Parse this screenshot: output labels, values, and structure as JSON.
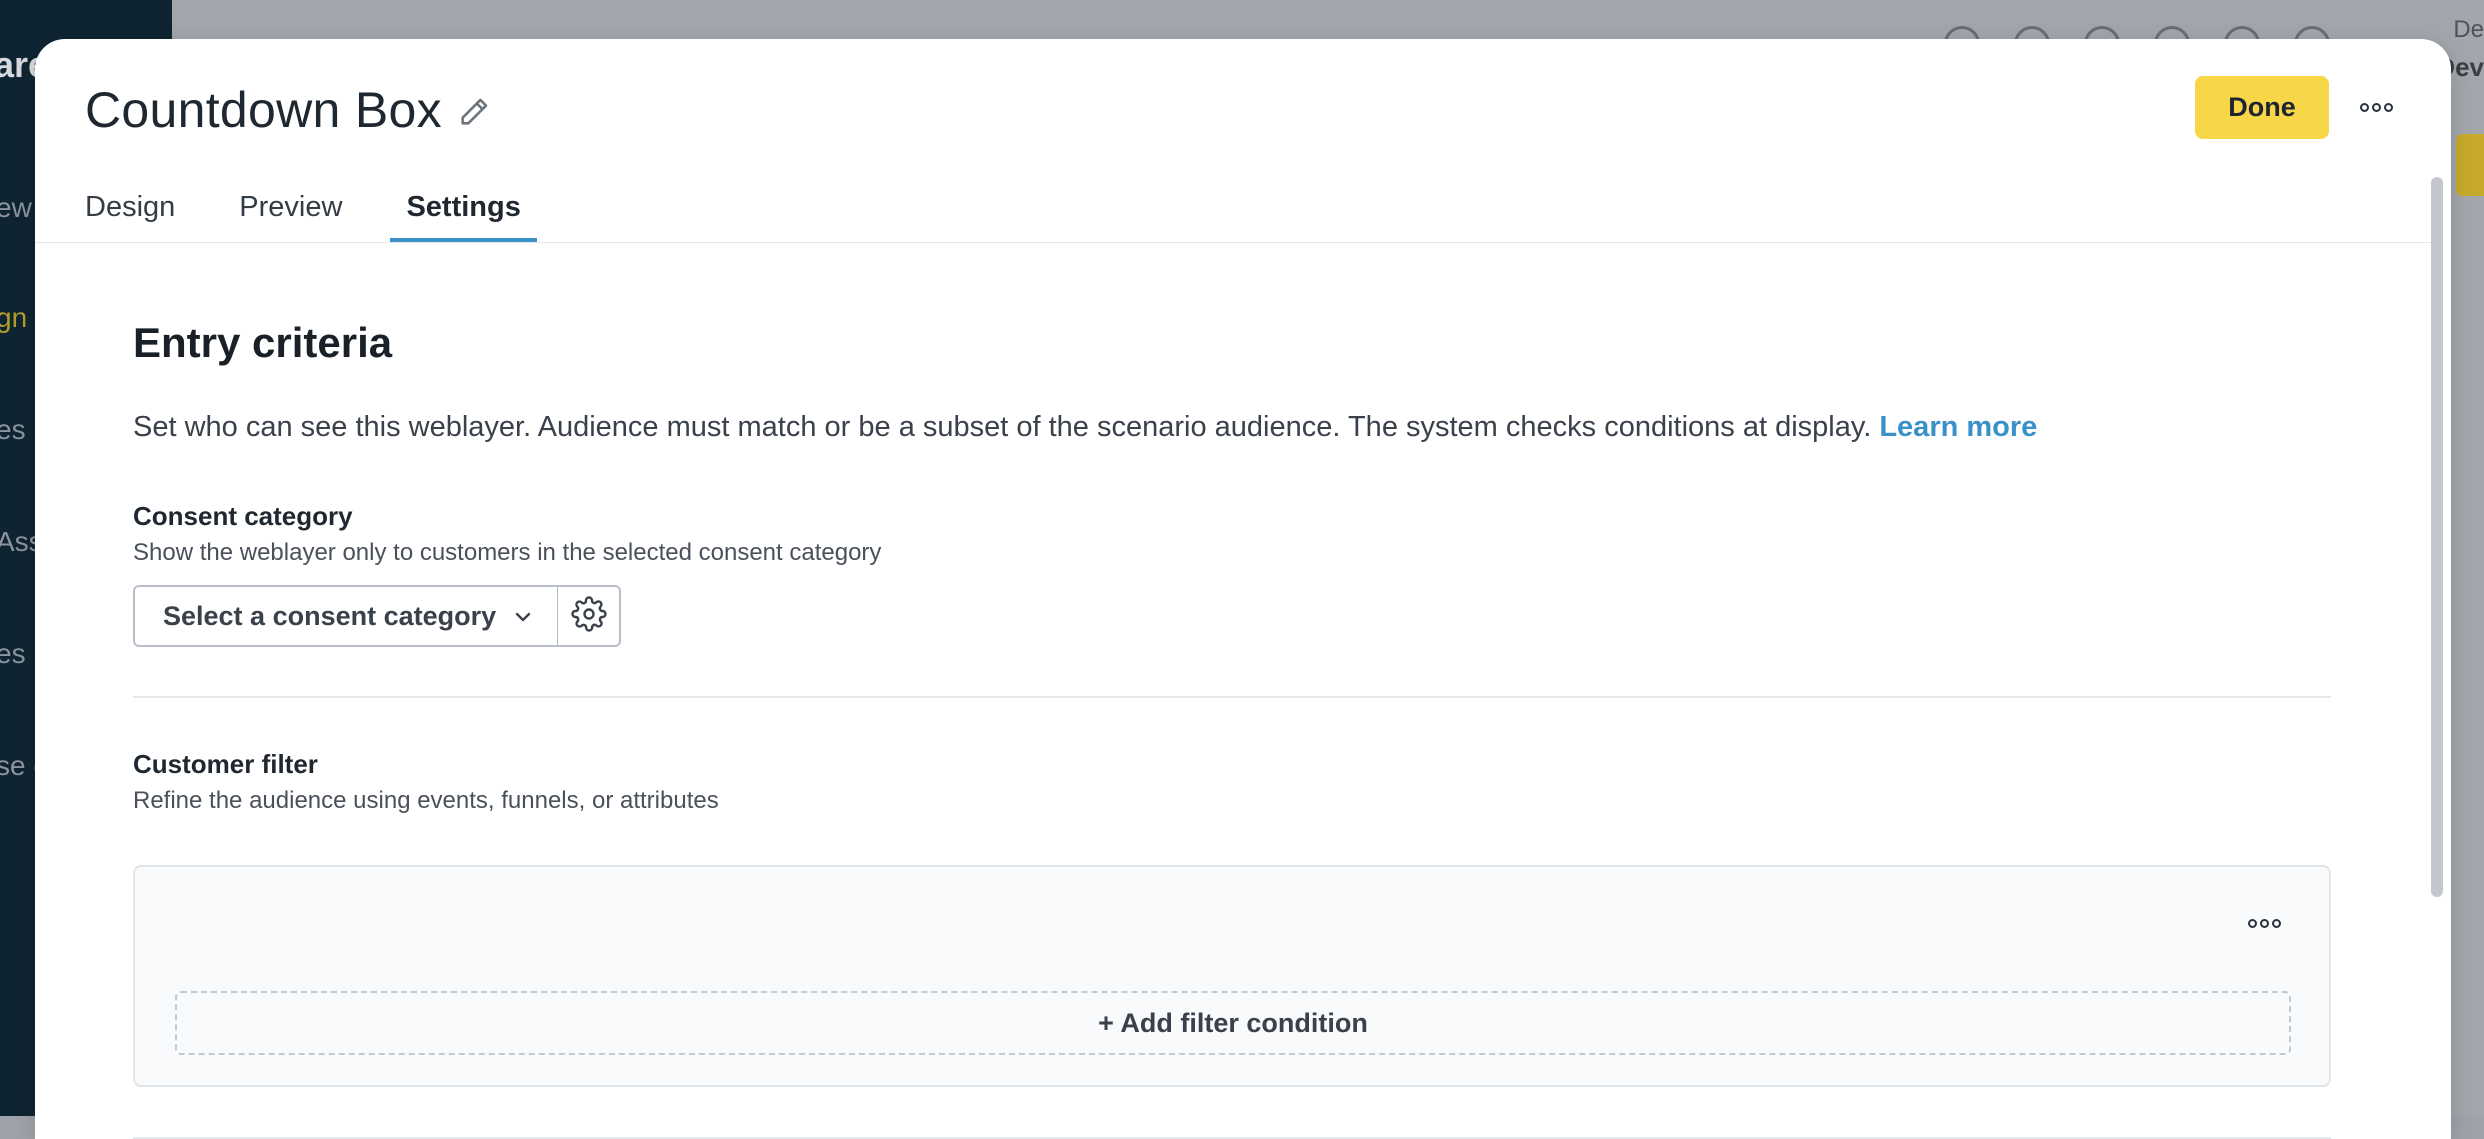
{
  "background": {
    "sidebar_logo": "are",
    "sidebar_items": [
      "ew",
      "gn",
      "es",
      "Ass",
      "es",
      "se c"
    ],
    "user_name": "De",
    "user_org": "Dev"
  },
  "modal": {
    "title": "Countdown Box",
    "done_label": "Done",
    "tabs": [
      {
        "label": "Design",
        "active": false
      },
      {
        "label": "Preview",
        "active": false
      },
      {
        "label": "Settings",
        "active": true
      }
    ]
  },
  "entry_criteria": {
    "heading": "Entry criteria",
    "description": "Set who can see this weblayer. Audience must match or be a subset of the scenario audience. The system checks conditions at display. ",
    "learn_more": "Learn more"
  },
  "consent": {
    "label": "Consent category",
    "help": "Show the weblayer only to customers in the selected consent category",
    "select_placeholder": "Select a consent category"
  },
  "customer_filter": {
    "label": "Customer filter",
    "help": "Refine the audience using events, funnels, or attributes",
    "add_condition": "+ Add filter condition"
  },
  "colors": {
    "accent": "#3a91c8",
    "primary_button": "#f7d648",
    "sidebar": "#0f2432"
  }
}
